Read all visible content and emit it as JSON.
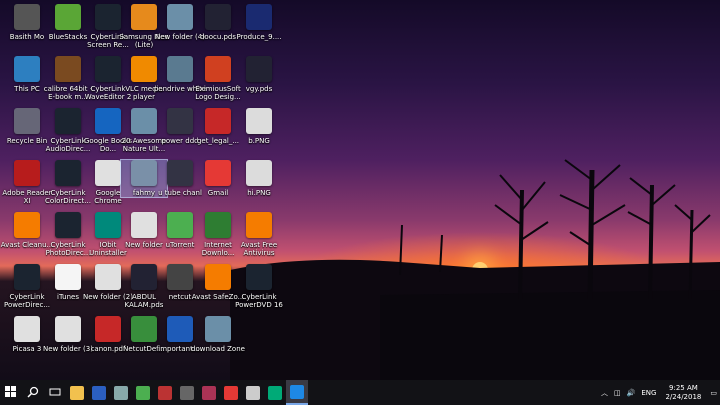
{
  "desktop_icons": [
    {
      "label": "Basith Mo",
      "icon": "user-folder-icon",
      "color": "#555"
    },
    {
      "label": "BlueStacks",
      "icon": "bluestacks-icon",
      "color": "#5aa636"
    },
    {
      "label": "CyberLink Screen Re...",
      "icon": "cyberlink-screen-icon",
      "color": "#1b2430"
    },
    {
      "label": "Samsung Kies (Lite)",
      "icon": "kies-icon",
      "color": "#e68a1c"
    },
    {
      "label": "New folder (4)",
      "icon": "folder-icon",
      "color": "#6b8fa8"
    },
    {
      "label": "doocu.pds",
      "icon": "file-icon",
      "color": "#223"
    },
    {
      "label": "Produce_9....",
      "icon": "produce-icon",
      "color": "#1a2a70"
    },
    {
      "label": "This PC",
      "icon": "this-pc-icon",
      "color": "#2d7fc0"
    },
    {
      "label": "calibre 64bit - E-book m...",
      "icon": "calibre-icon",
      "color": "#7a4a20"
    },
    {
      "label": "CyberLink WaveEditor 2",
      "icon": "wave-editor-icon",
      "color": "#1b2430"
    },
    {
      "label": "VLC media player",
      "icon": "vlc-icon",
      "color": "#f08a00"
    },
    {
      "label": "pendrive white",
      "icon": "folder-icon",
      "color": "#5a7a90"
    },
    {
      "label": "EximiousSoft Logo Desig...",
      "icon": "eximious-icon",
      "color": "#d04020"
    },
    {
      "label": "vgy.pds",
      "icon": "file-icon",
      "color": "#223"
    },
    {
      "label": "Recycle Bin",
      "icon": "recycle-bin-icon",
      "color": "#667"
    },
    {
      "label": "CyberLink AudioDirec...",
      "icon": "audiodirector-icon",
      "color": "#1b2430"
    },
    {
      "label": "Google Books Do...",
      "icon": "google-books-icon",
      "color": "#1565c0"
    },
    {
      "label": "20 Awesome Nature Ult...",
      "icon": "folder-icon",
      "color": "#6b8fa8"
    },
    {
      "label": "power ddd",
      "icon": "file-icon",
      "color": "#334"
    },
    {
      "label": "get_legal_...",
      "icon": "pdf-icon",
      "color": "#c62828"
    },
    {
      "label": "b.PNG",
      "icon": "image-file-icon",
      "color": "#dcdcdc"
    },
    {
      "label": "Adobe Reader XI",
      "icon": "adobe-reader-icon",
      "color": "#b71c1c"
    },
    {
      "label": "CyberLink ColorDirect...",
      "icon": "colordirector-icon",
      "color": "#1b2430"
    },
    {
      "label": "Google Chrome",
      "icon": "chrome-icon",
      "color": "#e0e0e0"
    },
    {
      "label": "fahmy",
      "icon": "file-icon",
      "color": "#7a90a8"
    },
    {
      "label": "u tube chanl",
      "icon": "file-icon",
      "color": "#334"
    },
    {
      "label": "Gmail",
      "icon": "gmail-icon",
      "color": "#e53935"
    },
    {
      "label": "hi.PNG",
      "icon": "image-file-icon",
      "color": "#dcdcdc"
    },
    {
      "label": "Avast Cleanu...",
      "icon": "avast-cleanup-icon",
      "color": "#f57c00"
    },
    {
      "label": "CyberLink PhotoDirec...",
      "icon": "photodirector-icon",
      "color": "#1b2430"
    },
    {
      "label": "IObit Uninstaller",
      "icon": "iobit-icon",
      "color": "#00897b"
    },
    {
      "label": "New folder",
      "icon": "chrome-icon",
      "color": "#e0e0e0"
    },
    {
      "label": "uTorrent",
      "icon": "utorrent-icon",
      "color": "#4caf50"
    },
    {
      "label": "Internet Downlo...",
      "icon": "idm-icon",
      "color": "#2e7d32"
    },
    {
      "label": "Avast Free Antivirus",
      "icon": "avast-icon",
      "color": "#f57c00"
    },
    {
      "label": "CyberLink PowerDirec...",
      "icon": "powerdirector-icon",
      "color": "#1b2430"
    },
    {
      "label": "iTunes",
      "icon": "itunes-icon",
      "color": "#f5f5f5"
    },
    {
      "label": "New folder (2)",
      "icon": "chrome-icon",
      "color": "#e0e0e0"
    },
    {
      "label": "ABDUL KALAM.pds",
      "icon": "file-icon",
      "color": "#223"
    },
    {
      "label": "netcut",
      "icon": "netcut-icon",
      "color": "#444"
    },
    {
      "label": "Avast SafeZo...",
      "icon": "avast-safezone-icon",
      "color": "#f57c00"
    },
    {
      "label": "CyberLink PowerDVD 16",
      "icon": "powerdvd-icon",
      "color": "#1b2430"
    },
    {
      "label": "Picasa 3",
      "icon": "picasa-icon",
      "color": "#e0e0e0"
    },
    {
      "label": "New folder (3)",
      "icon": "chrome-icon",
      "color": "#e0e0e0"
    },
    {
      "label": "canon.pdf",
      "icon": "pdf-icon",
      "color": "#c62828"
    },
    {
      "label": "NetcutDef...",
      "icon": "netcut-defender-icon",
      "color": "#388e3c"
    },
    {
      "label": "important....",
      "icon": "word-doc-icon",
      "color": "#1e5bb8"
    },
    {
      "label": "download Zone",
      "icon": "folder-icon",
      "color": "#6b8fa8"
    }
  ],
  "taskbar": {
    "apps": [
      {
        "icon": "start-icon"
      },
      {
        "icon": "search-icon"
      },
      {
        "icon": "task-view-icon"
      },
      {
        "icon": "file-explorer-icon",
        "color": "#f2c14e"
      },
      {
        "icon": "word-icon",
        "color": "#2b5fc0"
      },
      {
        "icon": "edge-icon",
        "color": "#8aa"
      },
      {
        "icon": "utorrent-icon",
        "color": "#4caf50"
      },
      {
        "icon": "app-icon",
        "color": "#b33"
      },
      {
        "icon": "calculator-icon",
        "color": "#666"
      },
      {
        "icon": "app-icon",
        "color": "#a35"
      },
      {
        "icon": "chrome-icon",
        "color": "#e53935"
      },
      {
        "icon": "settings-icon",
        "color": "#ccc"
      },
      {
        "icon": "screen-recorder-icon",
        "color": "#0a7"
      },
      {
        "icon": "cyberlink-icon",
        "color": "#1e88e5"
      }
    ],
    "tray_language": "ENG",
    "time": "9:25 AM",
    "date": "2/24/2018"
  }
}
